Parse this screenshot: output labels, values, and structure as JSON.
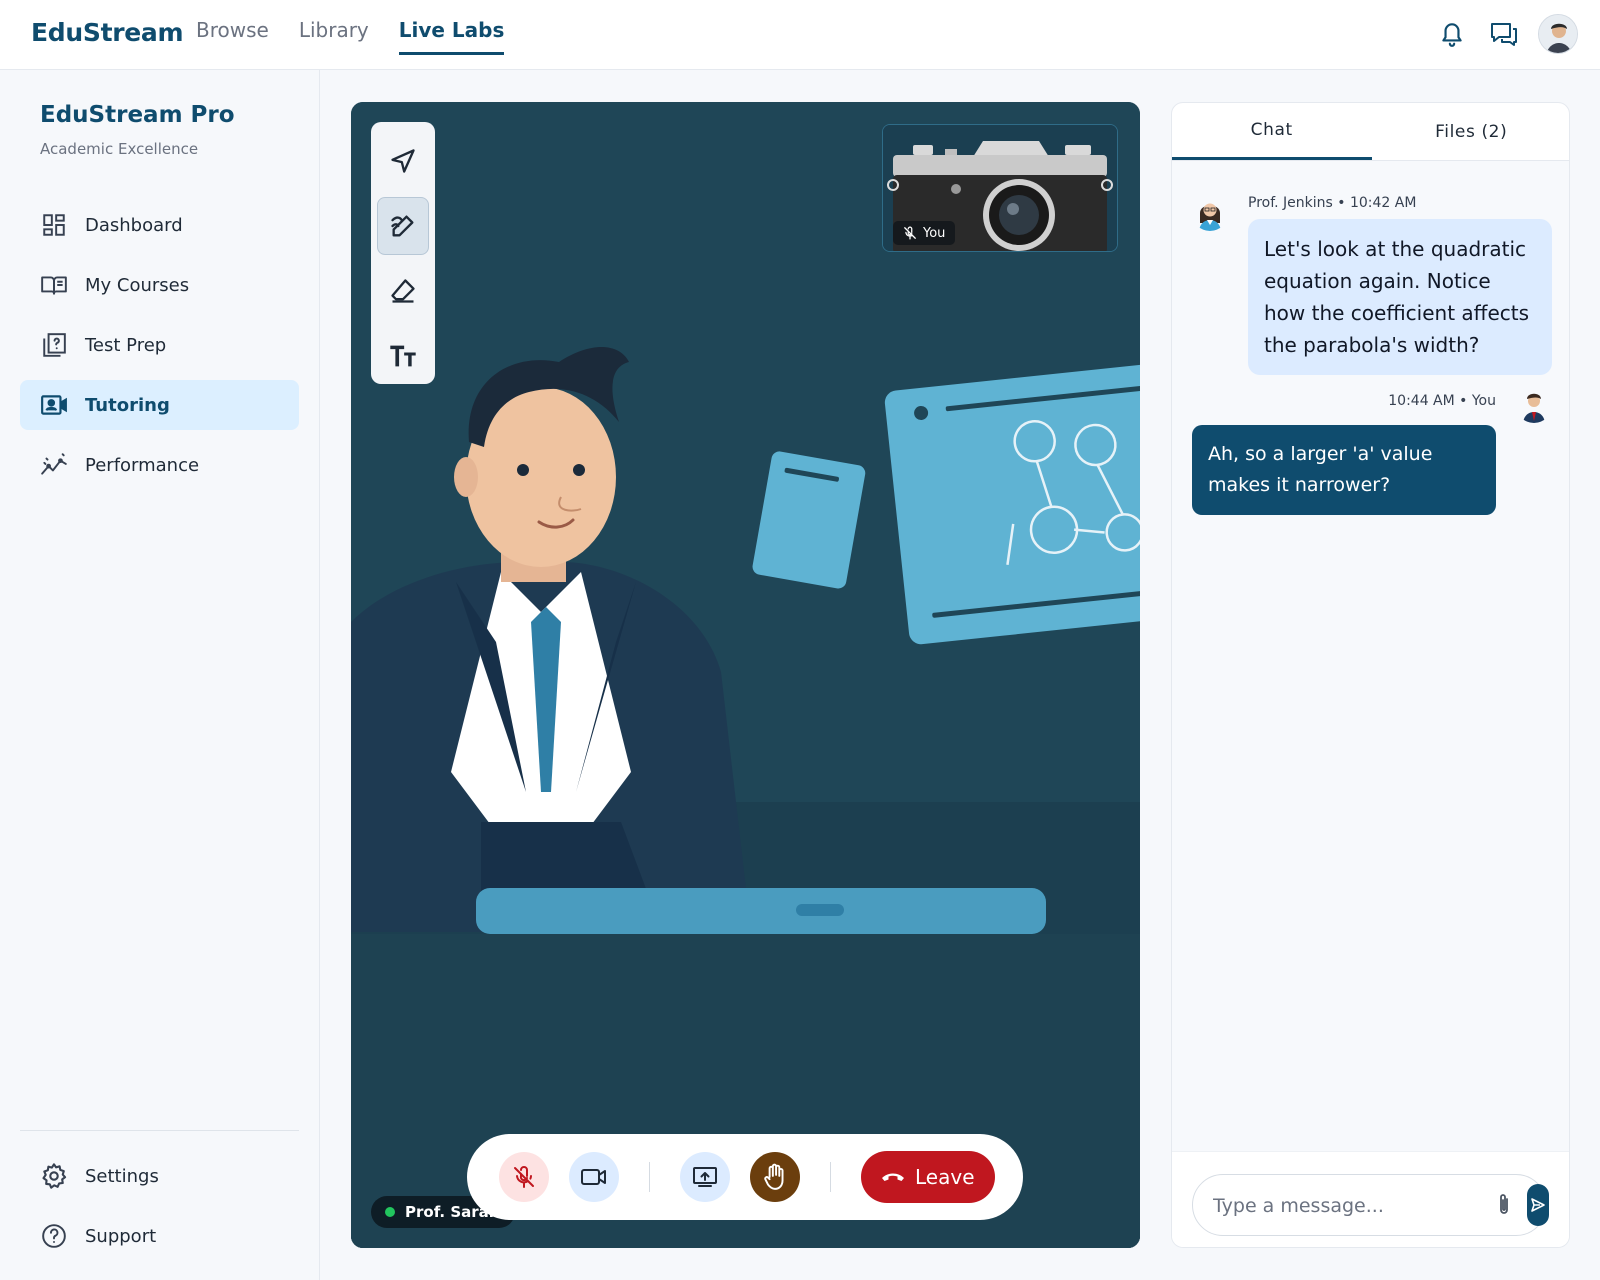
{
  "app": {
    "brand": "EduStream",
    "nav": [
      {
        "label": "Browse",
        "active": false
      },
      {
        "label": "Library",
        "active": false
      },
      {
        "label": "Live Labs",
        "active": true
      }
    ],
    "icons": [
      "bell-icon",
      "messages-icon",
      "user-avatar"
    ]
  },
  "sidebar": {
    "title": "EduStream Pro",
    "subtitle": "Academic Excellence",
    "items": [
      {
        "label": "Dashboard",
        "icon": "dashboard-icon",
        "active": false
      },
      {
        "label": "My Courses",
        "icon": "book-icon",
        "active": false
      },
      {
        "label": "Test Prep",
        "icon": "quiz-icon",
        "active": false
      },
      {
        "label": "Tutoring",
        "icon": "video-call-icon",
        "active": true
      },
      {
        "label": "Performance",
        "icon": "chart-line-icon",
        "active": false
      }
    ],
    "bottom": [
      {
        "label": "Settings",
        "icon": "gear-icon"
      },
      {
        "label": "Support",
        "icon": "help-icon"
      }
    ]
  },
  "stage": {
    "self_label": "You",
    "speaker_label": "Prof. Sarah",
    "tools": [
      "pointer-icon",
      "pen-icon",
      "eraser-icon",
      "text-icon"
    ],
    "active_tool": "pen-icon",
    "controls": {
      "leave_label": "Leave"
    }
  },
  "chat": {
    "tabs": [
      {
        "label": "Chat",
        "active": true
      },
      {
        "label": "Files (2)",
        "active": false
      }
    ],
    "messages": [
      {
        "meta": "Prof. Jenkins • 10:42 AM",
        "text": "Let's look at the quadratic equation again. Notice how the coefficient affects the parabola's width?",
        "from_me": false
      },
      {
        "meta": "10:44 AM • You",
        "text": "Ah, so a larger 'a' value makes it narrower?",
        "from_me": true
      }
    ],
    "input_placeholder": "Type a message..."
  },
  "colors": {
    "brand": "#0f4c6e",
    "stage_bg": "#1f4657",
    "leave": "#c0171f",
    "active_nav_bg": "#dcefff",
    "incoming_bubble": "#dcebff"
  }
}
